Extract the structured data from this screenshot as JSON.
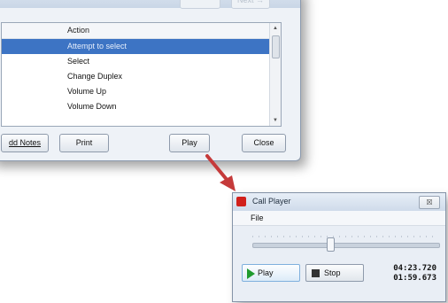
{
  "top_window": {
    "ghost_button_1": "",
    "ghost_button_2": "Next →",
    "list": {
      "header": "Action",
      "items": [
        "Attempt to select",
        "Select",
        "Change Duplex",
        "Volume Up",
        "Volume Down"
      ]
    },
    "buttons": {
      "add_notes": "dd Notes",
      "print": "Print",
      "play": "Play",
      "close": "Close"
    }
  },
  "call_player": {
    "title": "Call Player",
    "close_glyph": "☒",
    "menu_file": "File",
    "seek_position": 0.42,
    "play_label": "Play",
    "stop_label": "Stop",
    "time_total": "04:23.720",
    "time_current": "01:59.673"
  },
  "colors": {
    "selection": "#3d74c4",
    "arrow": "#c53a3a",
    "play_icon": "#1e9b2f",
    "app_icon": "#d1201b"
  }
}
